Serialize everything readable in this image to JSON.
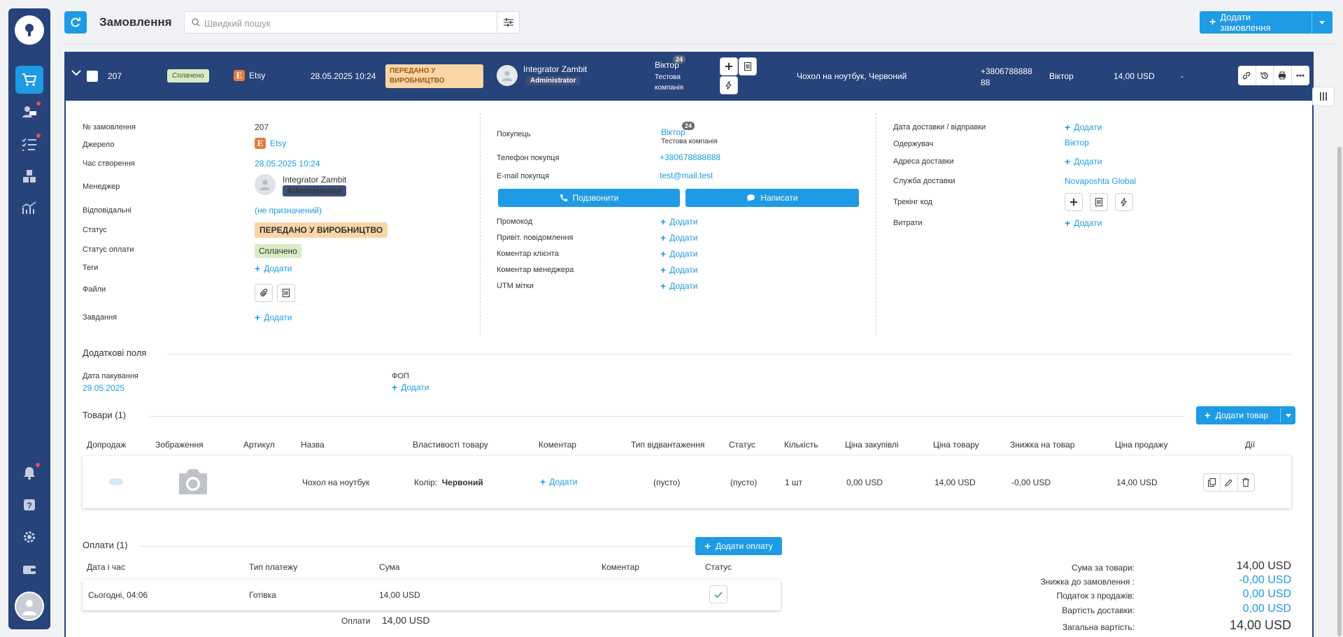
{
  "topbar": {
    "title": "Замовлення",
    "search_placeholder": "Швидкий пошук",
    "add_order_label": "Додати замовлення"
  },
  "order": {
    "number": "207",
    "payment_status": "Сплачено",
    "source": "Etsy",
    "created": "28.05.2025 10:24",
    "status": "ПЕРЕДАНО У ВИРОБНИЦТВО",
    "manager_name": "Integrator Zambit",
    "manager_role": "Administrator",
    "buyer_name": "Віктор",
    "buyer_count": "24",
    "buyer_company": "Тестова компанія",
    "product_summary": "Чохол на ноутбук, Червоний",
    "phone": "+380678888888",
    "recipient": "Віктор",
    "total": "14,00 USD",
    "dash": "-"
  },
  "details": {
    "labels": {
      "order_no": "№ замовлення",
      "source": "Джерело",
      "created": "Час створення",
      "manager": "Менеджер",
      "responsible": "Відповідальні",
      "status": "Статус",
      "payment_status": "Статус оплати",
      "tags": "Теги",
      "files": "Файли",
      "tasks": "Завдання"
    },
    "responsible_value": "(не призначений)",
    "add": "Додати"
  },
  "buyer": {
    "labels": {
      "buyer": "Покупець",
      "phone": "Телефон покупця",
      "email": "E-mail покупця",
      "promo": "Промокод",
      "greeting": "Привіт. повідомлення",
      "client_comment": "Коментар клієнта",
      "manager_comment": "Коментар менеджера",
      "utm": "UTM мітки"
    },
    "email": "test@mail.test",
    "call": "Подзвонити",
    "write": "Написати"
  },
  "delivery": {
    "labels": {
      "date": "Дата доставки / відправки",
      "recipient": "Одержувач",
      "address": "Адреса доставки",
      "service": "Служба доставки",
      "tracking": "Трекінг код",
      "expenses": "Витрати"
    },
    "service_value": "Novaposhta Global"
  },
  "extra": {
    "title": "Додаткові поля",
    "pack_date_label": "Дата пакування",
    "pack_date": "29.05.2025",
    "fop_label": "ФОП"
  },
  "products": {
    "title": "Товари (1)",
    "add_label": "Додати товар",
    "headers": [
      "Допродаж",
      "Зображення",
      "Артикул",
      "Назва",
      "Властивості товару",
      "Коментар",
      "Тип відвантаження",
      "Статус",
      "Кількість",
      "Ціна закупівлі",
      "Ціна товару",
      "Знижка на товар",
      "Ціна продажу",
      "Дії"
    ],
    "row": {
      "name": "Чохол на ноутбук",
      "prop_label": "Колір:",
      "prop_value": "Червоний",
      "ship_type": "(пусто)",
      "status": "(пусто)",
      "qty": "1 шт",
      "purchase": "0,00 USD",
      "price": "14,00 USD",
      "discount": "-0,00 USD",
      "sale": "14,00 USD"
    }
  },
  "payments": {
    "title": "Оплати (1)",
    "add_label": "Додати оплату",
    "headers": [
      "Дата і час",
      "Тип платежу",
      "Сума",
      "Коментар",
      "Статус"
    ],
    "row": {
      "date": "Сьогодні, 04:06",
      "type": "Готівка",
      "amount": "14,00 USD"
    },
    "total_label": "Оплати",
    "total": "14,00 USD"
  },
  "summary": {
    "goods_label": "Сума за товари:",
    "goods": "14,00 USD",
    "discount_label": "Знижка до замовлення :",
    "discount": "-0,00 USD",
    "tax_label": "Податок з продажів:",
    "tax": "0,00 USD",
    "delivery_label": "Вартість доставки:",
    "delivery": "0,00 USD",
    "total_label": "Загальна вартість:",
    "total": "14,00 USD"
  },
  "colors": {
    "accent": "#1e9be4",
    "nav": "#26437a"
  }
}
